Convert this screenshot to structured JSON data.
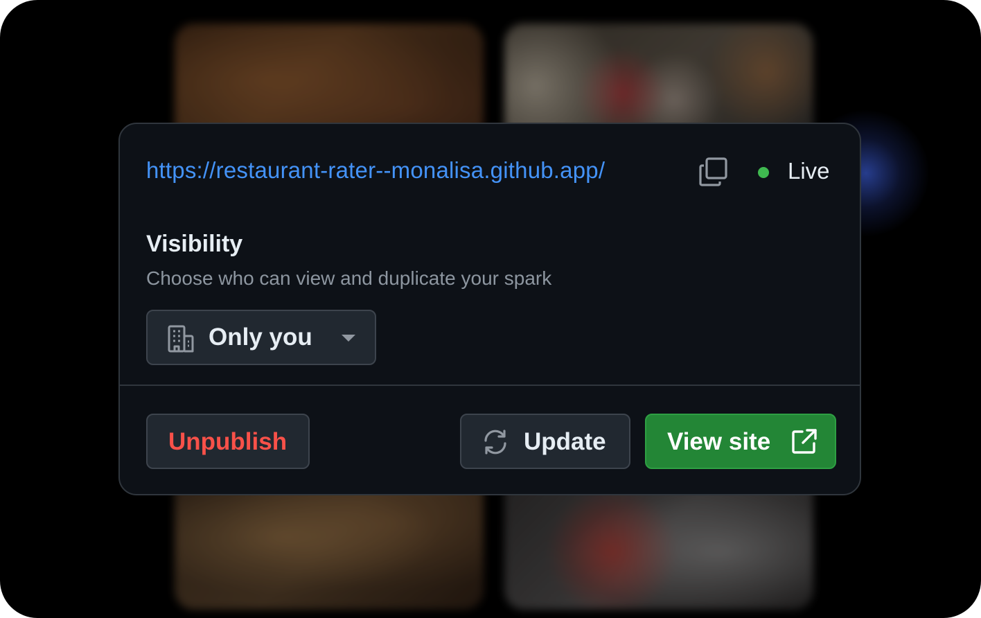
{
  "publish_panel": {
    "url": "https://restaurant-rater--monalisa.github.app/",
    "status_label": "Live",
    "status_color": "#3fb950",
    "visibility": {
      "title": "Visibility",
      "description": "Choose who can view and duplicate your spark",
      "selected_option": "Only you",
      "icon": "organization-icon"
    },
    "actions": {
      "unpublish_label": "Unpublish",
      "update_label": "Update",
      "view_site_label": "View site"
    },
    "icons": {
      "copy": "copy-icon",
      "update": "sync-icon",
      "view_site": "link-external-icon",
      "dropdown": "triangle-down-icon"
    }
  },
  "colors": {
    "link": "#4493f8",
    "danger": "#f85149",
    "primary_button": "#238636",
    "panel_background": "#0d1117"
  }
}
